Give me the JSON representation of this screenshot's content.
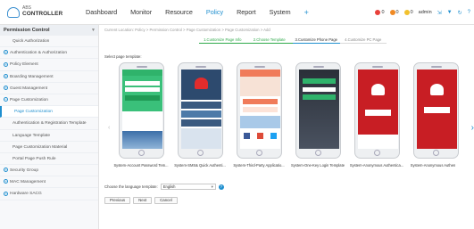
{
  "app": {
    "logo_small": "ABS",
    "logo_big": "CONTROLLER"
  },
  "topnav": [
    {
      "label": "Dashboard",
      "active": false
    },
    {
      "label": "Monitor",
      "active": false
    },
    {
      "label": "Resource",
      "active": false
    },
    {
      "label": "Policy",
      "active": true
    },
    {
      "label": "Report",
      "active": false
    },
    {
      "label": "System",
      "active": false
    },
    {
      "label": "+",
      "active": false
    }
  ],
  "top_right": {
    "alert_1": "0",
    "alert_2": "0",
    "alert_3": "0",
    "user": "admin",
    "colors": {
      "critical": "#e8403a",
      "major": "#f08a24",
      "minor": "#f2c12e"
    }
  },
  "sidebar": {
    "title": "Permission Control",
    "items": [
      {
        "label": "Quick Authorization",
        "kind": "sub"
      },
      {
        "label": "Authentication & Authorization",
        "kind": "group"
      },
      {
        "label": "Policy Element",
        "kind": "group"
      },
      {
        "label": "Boarding Management",
        "kind": "group"
      },
      {
        "label": "Guest Management",
        "kind": "group"
      },
      {
        "label": "Page Customization",
        "kind": "group-open"
      },
      {
        "label": "Page Customization",
        "kind": "sub-selected"
      },
      {
        "label": "Authentication & Registration Template",
        "kind": "sub"
      },
      {
        "label": "Language Template",
        "kind": "sub"
      },
      {
        "label": "Page Customization Material",
        "kind": "sub"
      },
      {
        "label": "Portal Page Push Rule",
        "kind": "sub"
      },
      {
        "label": "Security Group",
        "kind": "group"
      },
      {
        "label": "MAC Management",
        "kind": "group"
      },
      {
        "label": "Hardware SACG",
        "kind": "group"
      }
    ]
  },
  "main": {
    "breadcrumb": "Current Location: Policy > Permission Control > Page Customization > Page Customization > Add",
    "steps": [
      {
        "label": "1.Customize Page Info",
        "state": "done"
      },
      {
        "label": "2.Choose Template",
        "state": "done"
      },
      {
        "label": "3.Customize Phone Page",
        "state": "current"
      },
      {
        "label": "4.Customize PC Page",
        "state": "todo"
      }
    ],
    "select_label": "Select page template:",
    "templates": [
      {
        "name": "System-Account Password Tem...",
        "style": "green"
      },
      {
        "name": "System-SMS& Quick Authenti...",
        "style": "huawei-blue"
      },
      {
        "name": "System-Third-Party Applicatio...",
        "style": "social"
      },
      {
        "name": "System-One-Key Login Template",
        "style": "dark-login"
      },
      {
        "name": "System-Anonymous Authentica...",
        "style": "red-anon"
      },
      {
        "name": "System-Anonymous Authen",
        "style": "red-huawei"
      }
    ],
    "language_label": "Choose the language template:",
    "language_value": "English",
    "help": "?",
    "buttons": {
      "previous": "Previous",
      "next": "Next",
      "cancel": "Cancel"
    }
  },
  "icons": {
    "search": "search-icon",
    "settings": "gear-icon",
    "help": "help-icon"
  }
}
